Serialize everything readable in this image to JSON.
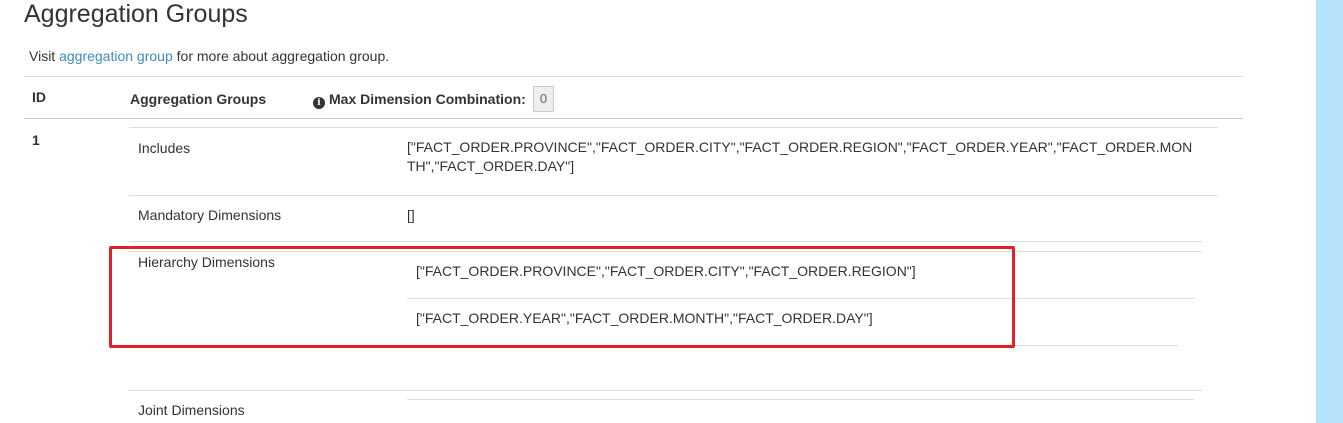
{
  "page": {
    "title": "Aggregation Groups",
    "visit_prefix": "Visit ",
    "visit_link": "aggregation group",
    "visit_suffix": " for more about aggregation group."
  },
  "table": {
    "header_id": "ID",
    "header_groups": "Aggregation Groups",
    "header_max_combo": "Max Dimension Combination:",
    "max_combo_value": "0",
    "rows": [
      {
        "id": "1",
        "includes_label": "Includes",
        "includes_value": "[\"FACT_ORDER.PROVINCE\",\"FACT_ORDER.CITY\",\"FACT_ORDER.REGION\",\"FACT_ORDER.YEAR\",\"FACT_ORDER.MONTH\",\"FACT_ORDER.DAY\"]",
        "mandatory_label": "Mandatory Dimensions",
        "mandatory_value": "[]",
        "hierarchy_label": "Hierarchy Dimensions",
        "hierarchy_values": [
          "[\"FACT_ORDER.PROVINCE\",\"FACT_ORDER.CITY\",\"FACT_ORDER.REGION\"]",
          "[\"FACT_ORDER.YEAR\",\"FACT_ORDER.MONTH\",\"FACT_ORDER.DAY\"]"
        ],
        "joint_label": "Joint Dimensions"
      }
    ]
  },
  "colors": {
    "link": "#3c8dbc",
    "highlight": "#e0212b",
    "side_panel": "#b7e2fb"
  }
}
